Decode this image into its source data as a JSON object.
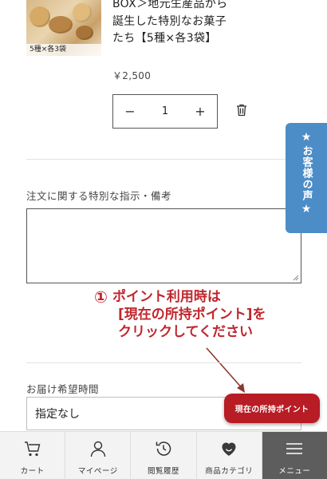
{
  "product": {
    "thumb_caption": "5種×各3袋",
    "title": "BOX＞地元生産品から誕生した特別なお菓子たち【5種×各3袋】",
    "price": "￥2,500",
    "quantity": "1",
    "minus_label": "−",
    "plus_label": "+"
  },
  "note": {
    "label": "注文に関する特別な指示・備考",
    "value": ""
  },
  "voice_tab": {
    "star": "★",
    "label": "お客様の声"
  },
  "annotation": {
    "circled": "①",
    "line1": "ポイント利用時は",
    "line2": "[現在の所持ポイント]を",
    "line3": "クリックしてください"
  },
  "delivery": {
    "label": "お届け希望時間",
    "selected": "指定なし"
  },
  "points_button": {
    "label": "現在の所持ポイント"
  },
  "nav": {
    "cart": "カート",
    "mypage": "マイページ",
    "history": "閲覧履歴",
    "category": "商品カテゴリ",
    "menu": "メニュー"
  },
  "colors": {
    "accent_red": "#b81c24",
    "annotation_red": "#c0262d",
    "voice_tab_blue": "#4c8dc7",
    "menu_gray": "#5d5d5d"
  },
  "icons": [
    "cart-icon",
    "person-icon",
    "history-icon",
    "heart-icon",
    "hamburger-icon",
    "trash-icon",
    "star-icon"
  ]
}
